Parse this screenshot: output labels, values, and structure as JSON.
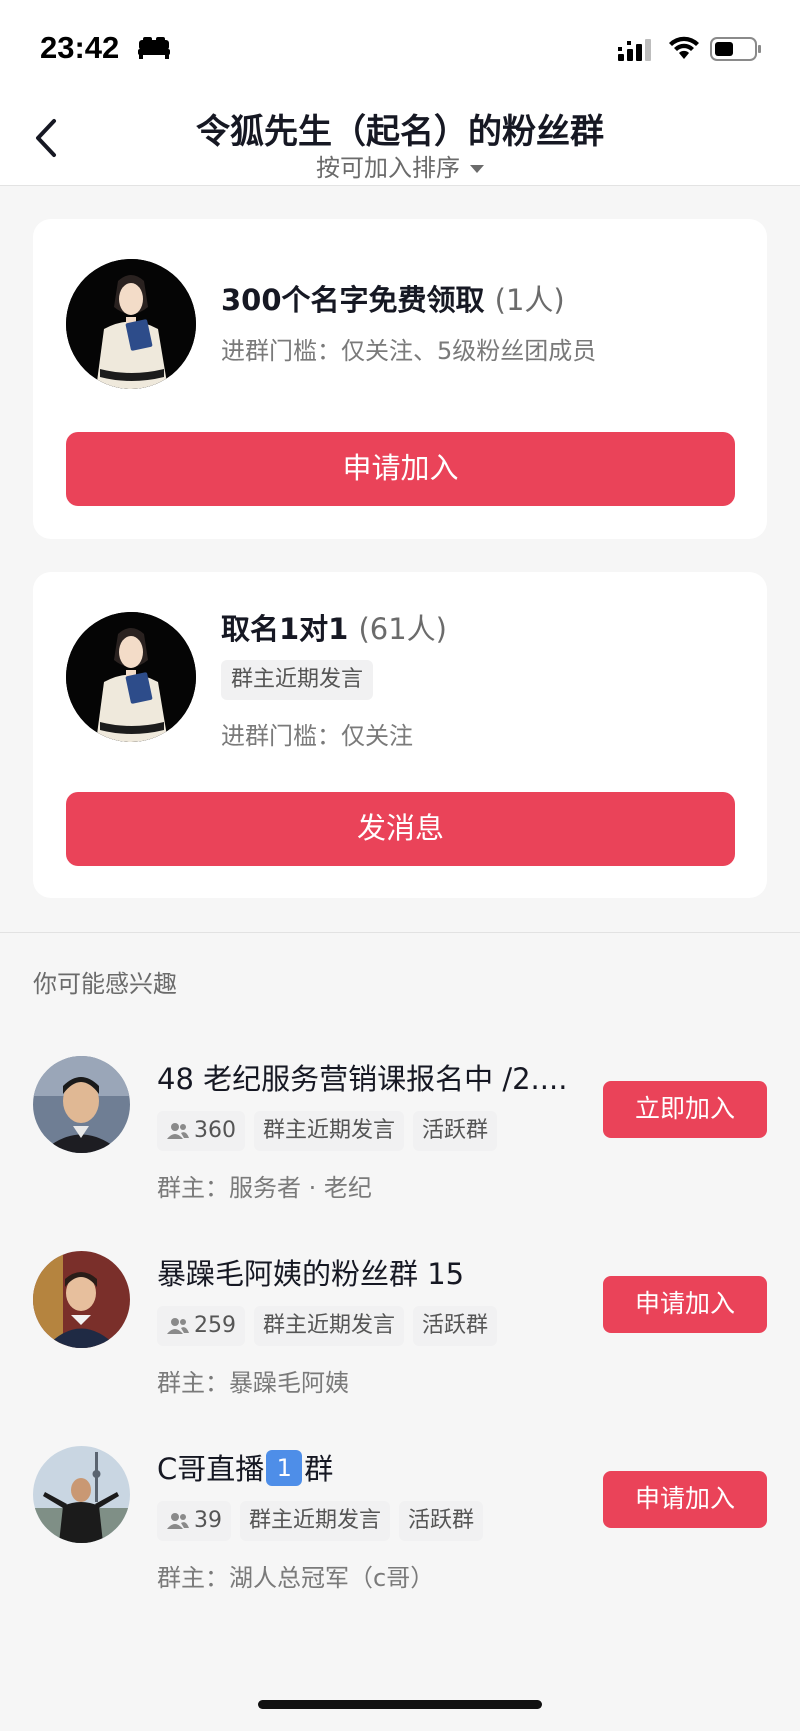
{
  "status_bar": {
    "time": "23:42",
    "icons": [
      "bed-icon",
      "signal-icon",
      "wifi-icon",
      "battery-icon"
    ]
  },
  "nav": {
    "title": "令狐先生（起名）的粉丝群",
    "sort_label": "按可加入排序",
    "back_icon": "chevron-left-icon"
  },
  "groups": [
    {
      "name": "300个名字免费领取",
      "count": "(1人)",
      "requirement": "进群门槛：仅关注、5级粉丝团成员",
      "button": "申请加入"
    },
    {
      "name": "取名1对1",
      "count": "(61人)",
      "tag": "群主近期发言",
      "requirement": "进群门槛：仅关注",
      "button": "发消息"
    }
  ],
  "section_title": "你可能感兴趣",
  "recommendations": [
    {
      "name": "48 老纪服务营销课报名中 /2....",
      "members": "360",
      "tags": [
        "群主近期发言",
        "活跃群"
      ],
      "owner": "群主：服务者 · 老纪",
      "button": "立即加入"
    },
    {
      "name": "暴躁毛阿姨的粉丝群 15",
      "members": "259",
      "tags": [
        "群主近期发言",
        "活跃群"
      ],
      "owner": "群主：暴躁毛阿姨",
      "button": "申请加入"
    },
    {
      "name_prefix": "C哥直播",
      "name_badge": "1",
      "name_suffix": "群",
      "members": "39",
      "tags": [
        "群主近期发言",
        "活跃群"
      ],
      "owner": "群主：湖人总冠军（c哥）",
      "button": "申请加入"
    }
  ],
  "colors": {
    "accent": "#ea4359",
    "background": "#f6f6f6",
    "card": "#ffffff",
    "tag_bg": "#f1f1f2",
    "badge_blue": "#4e8ee8"
  }
}
